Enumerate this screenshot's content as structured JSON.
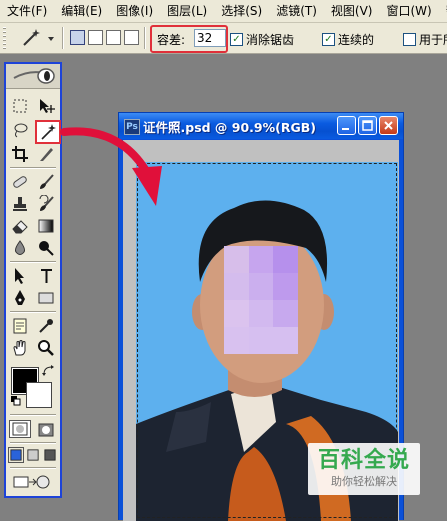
{
  "menubar": {
    "items": [
      {
        "label": "文件(F)"
      },
      {
        "label": "编辑(E)"
      },
      {
        "label": "图像(I)"
      },
      {
        "label": "图层(L)"
      },
      {
        "label": "选择(S)"
      },
      {
        "label": "滤镜(T)"
      },
      {
        "label": "视图(V)"
      },
      {
        "label": "窗口(W)"
      },
      {
        "label": "帮"
      }
    ]
  },
  "options": {
    "tolerance_label": "容差:",
    "tolerance_value": "32",
    "anti_alias_label": "消除锯齿",
    "anti_alias_checked": "✓",
    "contiguous_label": "连续的",
    "contiguous_checked": "✓",
    "sample_all_label": "用于所"
  },
  "document": {
    "title": "证件照.psd @ 90.9%(RGB)",
    "icon_text": "Ps"
  },
  "watermark": {
    "title": "百科全说",
    "subtitle": "助你轻松解决"
  },
  "colors": {
    "highlight_red": "#e0303a",
    "toolbox_border": "#1d43d8",
    "photo_background": "#5db0ee",
    "titlebar": "#0a5be0"
  },
  "icons": [
    "magic-wand-icon",
    "marquee-icon",
    "move-icon",
    "lasso-icon",
    "crop-icon",
    "slice-icon",
    "healing-brush-icon",
    "brush-icon",
    "clone-stamp-icon",
    "history-brush-icon",
    "eraser-icon",
    "gradient-icon",
    "blur-icon",
    "dodge-icon",
    "path-select-icon",
    "type-icon",
    "pen-icon",
    "shape-icon",
    "notes-icon",
    "eyedropper-icon",
    "hand-icon",
    "zoom-icon"
  ]
}
